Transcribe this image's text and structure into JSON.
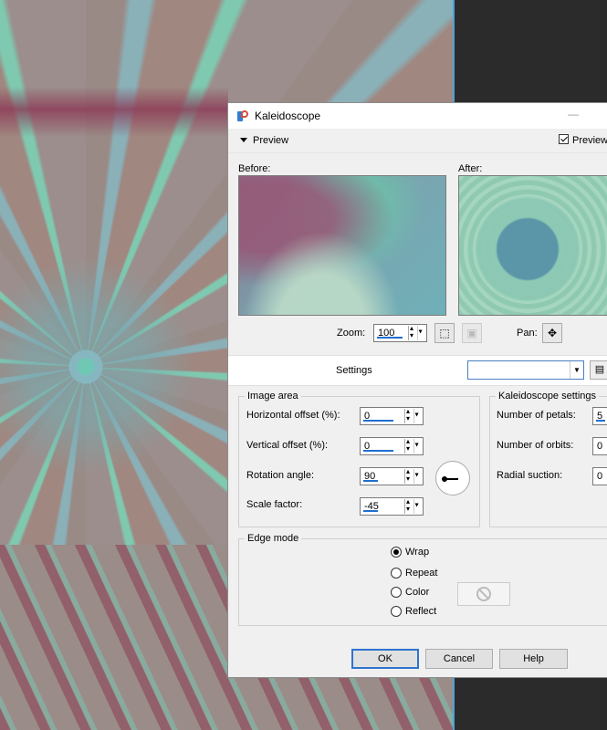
{
  "dialog": {
    "title": "Kaleidoscope",
    "minimize_glyph": "—",
    "preview_section_label": "Preview",
    "preview_checkbox_label": "Preview",
    "preview_checked": true
  },
  "preview": {
    "before_label": "Before:",
    "after_label": "After:",
    "zoom_label": "Zoom:",
    "zoom_value": "100",
    "pan_label": "Pan:"
  },
  "settings": {
    "label": "Settings",
    "preset_value": ""
  },
  "image_area": {
    "title": "Image area",
    "horizontal_offset_label": "Horizontal offset (%):",
    "horizontal_offset_value": "0",
    "vertical_offset_label": "Vertical offset (%):",
    "vertical_offset_value": "0",
    "rotation_angle_label": "Rotation angle:",
    "rotation_angle_value": "90",
    "scale_factor_label": "Scale factor:",
    "scale_factor_value": "-45"
  },
  "kaleidoscope_settings": {
    "title": "Kaleidoscope settings",
    "petals_label": "Number of petals:",
    "petals_value": "5",
    "orbits_label": "Number of orbits:",
    "orbits_value": "0",
    "radial_suction_label": "Radial suction:",
    "radial_suction_value": "0"
  },
  "edge_mode": {
    "title": "Edge mode",
    "options": [
      "Wrap",
      "Repeat",
      "Color",
      "Reflect"
    ],
    "selected": "Wrap"
  },
  "buttons": {
    "ok": "OK",
    "cancel": "Cancel",
    "help": "Help"
  },
  "colors": {
    "accent": "#1f6fd0",
    "canvas_edge": "#4aa3d9",
    "dialog_bg": "#f0f0f0"
  }
}
